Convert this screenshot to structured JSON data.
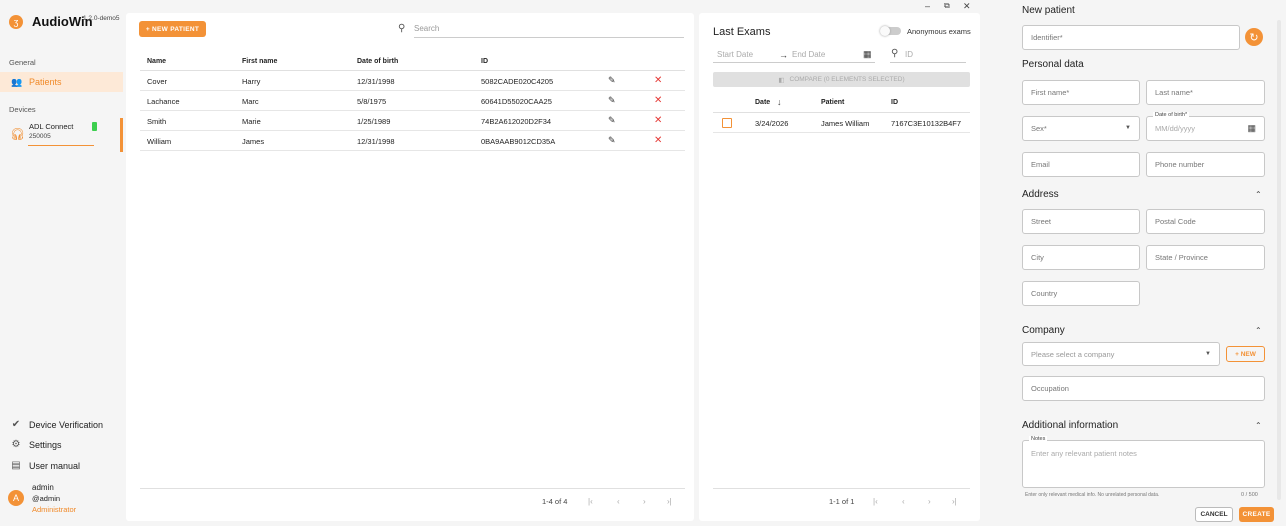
{
  "app": {
    "name": "AudioWin",
    "version": "1.2.0-demo5",
    "logo_icon": "ear-icon"
  },
  "window_controls": {
    "minimize": "–",
    "restore": "⧉",
    "close": "✕"
  },
  "sidebar": {
    "general_label": "General",
    "patients_label": "Patients",
    "devices_label": "Devices",
    "device": {
      "name": "ADL Connect",
      "serial": "250005"
    },
    "device_verification": "Device Verification",
    "settings": "Settings",
    "user_manual": "User manual",
    "user": {
      "name": "admin",
      "handle": "@admin",
      "role": "Administrator",
      "initial": "A"
    }
  },
  "patients": {
    "new_button": "+ NEW PATIENT",
    "search_placeholder": "Search",
    "columns": [
      "Name",
      "First name",
      "Date of birth",
      "ID"
    ],
    "rows": [
      [
        "Cover",
        "Harry",
        "12/31/1998",
        "5082CADE020C4205"
      ],
      [
        "Lachance",
        "Marc",
        "5/8/1975",
        "60641D55020CAA25"
      ],
      [
        "Smith",
        "Marie",
        "1/25/1989",
        "74B2A612020D2F34"
      ],
      [
        "William",
        "James",
        "12/31/1998",
        "0BA9AAB9012CD35A"
      ]
    ],
    "pagination": "1-4 of 4"
  },
  "exams": {
    "title": "Last Exams",
    "anonymous_label": "Anonymous exams",
    "start_placeholder": "Start Date",
    "end_placeholder": "End Date",
    "id_placeholder": "ID",
    "compare_button": "COMPARE (0 ELEMENTS SELECTED)",
    "columns": [
      "Date",
      "Patient",
      "ID"
    ],
    "rows": [
      [
        "3/24/2026",
        "James William",
        "7167C3E10132B4F7"
      ]
    ],
    "pagination": "1-1 of 1"
  },
  "new_patient": {
    "title": "New patient",
    "identifier_placeholder": "Identifier*",
    "personal_data": "Personal data",
    "first_name": "First name*",
    "last_name": "Last name*",
    "sex": "Sex*",
    "dob_label": "Date of birth*",
    "dob_placeholder": "MM/dd/yyyy",
    "email": "Email",
    "phone": "Phone number",
    "address": "Address",
    "street": "Street",
    "postal": "Postal Code",
    "city": "City",
    "state": "State / Province",
    "country": "Country",
    "company": "Company",
    "company_placeholder": "Please select a company",
    "new_company": "+ NEW",
    "occupation": "Occupation",
    "additional": "Additional information",
    "notes_label": "Notes",
    "notes_placeholder": "Enter any relevant patient notes",
    "notes_hint": "Enter only relevant medical info. No unrelated personal data.",
    "notes_count": "0 / 500",
    "cancel": "CANCEL",
    "create": "CREATE"
  },
  "colors": {
    "accent": "#f39237",
    "delete": "#e53935"
  }
}
